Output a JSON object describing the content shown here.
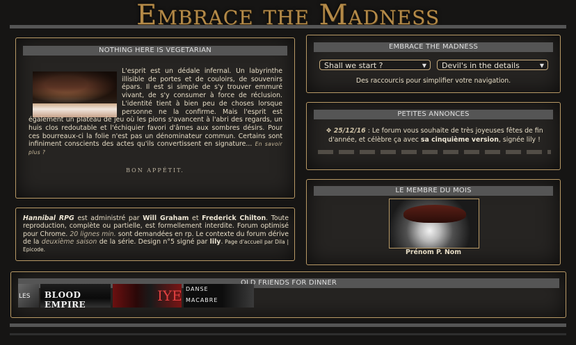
{
  "site": {
    "title": "Embrace the Madness"
  },
  "intro": {
    "heading": "NOTHING HERE IS VEGETARIAN",
    "text": "L'esprit est un dédale infernal. Un labyrinthe illisible de portes et de couloirs, de souvenirs épars. Il est si simple de s'y trouver emmuré vivant, de s'y consumer à force de réclusion. L'identité tient à bien peu de choses lorsque personne ne la confirme. Mais l'esprit est également un plateau de jeu où les pions s'avancent à l'abri des regards, un huis clos redoutable et l'échiquier favori d'âmes aux sombres désirs. Pour ces bourreaux-ci la folie n'est pas un dénominateur commun. Certains sont infiniment conscients des actes qu'ils convertissent en signature...",
    "more_link": "En savoir plus ?",
    "signoff": "BON APPÉTIT."
  },
  "credits": {
    "game_name": "Hannibal RPG",
    "t1": " est administré par ",
    "admin1": "Will Graham",
    "t2": " et ",
    "admin2": "Frederick Chilton",
    "t3": ". Toute reproduction, complète ou partielle, est formellement interdite. Forum optimisé pour Chrome. ",
    "lines_min": "20 lignes min.",
    "t4": " sont demandées en rp. Le contexte du forum dérive de la ",
    "season": "deuxième saison",
    "t5": " de la série. Design n°5 signé par ",
    "designer": "lily",
    "t6": ".",
    "small_credit": " Page d'accueil par Dila | ",
    "small_credit_2": "Epicode."
  },
  "nav": {
    "heading": "EMBRACE THE MADNESS",
    "select1": "Shall we start ?",
    "select2": "Devil's in the details",
    "hint": "Des raccourcis pour simplifier votre navigation."
  },
  "annonces": {
    "heading": "PETITES ANNONCES",
    "bullet": "❖",
    "date": "25/12/16",
    "t1": " : Le forum vous souhaite de très joyeuses fêtes de fin d'année, et célèbre ça avec ",
    "highlight": "sa cinquième version",
    "t2": ", signée lily !"
  },
  "member": {
    "heading": "LE MEMBRE DU MOIS",
    "name": "Prénom P. Nom"
  },
  "friends": {
    "heading": "OLD FRIENDS FOR DINNER",
    "banners": [
      {
        "label": "LES"
      },
      {
        "label": "BLOOD EMPIRE"
      },
      {
        "label": "IYE"
      },
      {
        "label": "DANSE",
        "label2": "MACABRE"
      }
    ]
  },
  "colors": {
    "accent": "#b48a48",
    "border": "#b99a66",
    "title_bar": "#555555",
    "background": "#161514"
  }
}
